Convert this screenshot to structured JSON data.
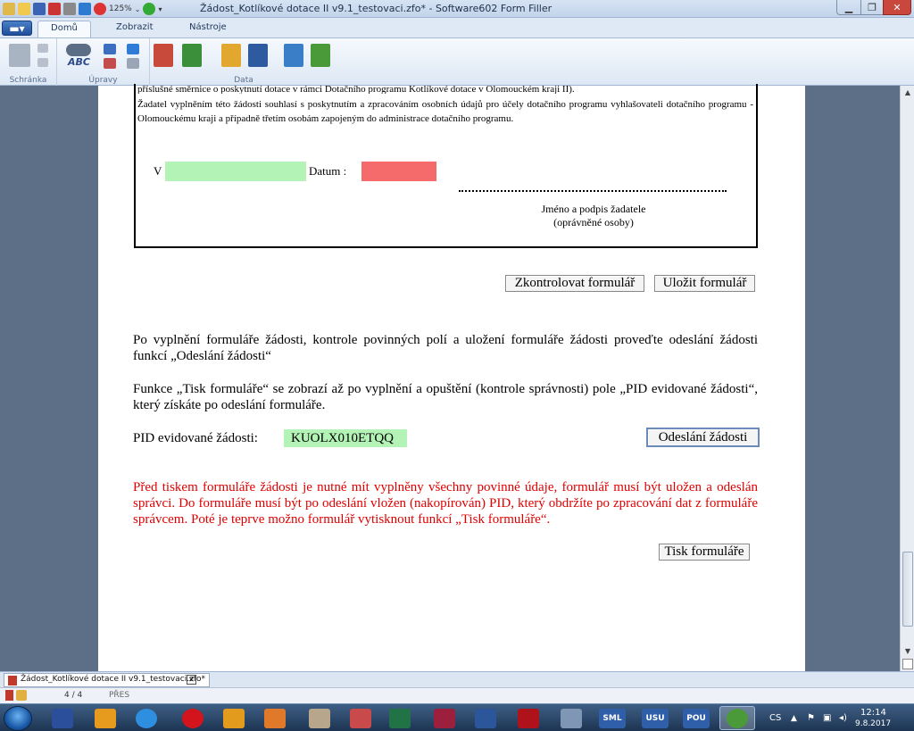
{
  "window": {
    "title": "Žádost_Kotlíkové dotace II v9.1_testovaci.zfo* - Software602 Form Filler",
    "zoom": "125%"
  },
  "ribbon": {
    "tabs": [
      "Domů",
      "Zobrazit",
      "Nástroje"
    ],
    "active_tab": "Domů",
    "groups": {
      "clipboard": "Schránka",
      "edit": "Úpravy",
      "data": "Data"
    },
    "spell_label": "ABC"
  },
  "form": {
    "consent_top": "příslušné směrnice o poskytnutí dotace v rámci Dotačního programu Kotlíkové dotace v Olomouckém kraji II).",
    "consent_text": "Žadatel vyplněním této žádosti souhlasí s poskytnutím a zpracováním osobních údajů pro účely dotačního programu vyhlašovateli dotačního programu - Olomouckému kraji a případně třetím osobám zapojeným do administrace dotačního programu.",
    "place_label": "V",
    "date_label": "Datum :",
    "signature_line1": "Jméno a podpis žadatele",
    "signature_line2": "(oprávněné osoby)",
    "check_button": "Zkontrolovat formulář",
    "save_button": "Uložit formulář",
    "instruction1": "Po vyplnění formuláře žádosti, kontrole povinných polí a uložení formuláře žádosti proveďte odeslání žádosti funkcí „Odeslání žádosti“",
    "instruction2": "Funkce „Tisk formuláře“ se zobrazí až po vyplnění a opuštění (kontrole správnosti) pole „PID evidované žádosti“, který získáte po odeslání formuláře.",
    "pid_label": "PID evidované žádosti:",
    "pid_value": "KUOLX010ETQQ",
    "send_button": "Odeslání žádosti",
    "warning": "Před tiskem formuláře žádosti je nutné mít vyplněny všechny povinné údaje, formulář musí být uložen a odeslán správci. Do formuláře musí být po odeslání vložen (nakopírován) PID, který obdržíte po zpracování dat z formuláře správcem. Poté je teprve možno formulář vytisknout funkcí „Tisk formuláře“.",
    "print_button": "Tisk formuláře"
  },
  "document_tab": "Žádost_Kotlíkové dotace II v9.1_testovaci.zfo*",
  "status": {
    "pages": "4 / 4",
    "mode": "PŘES"
  },
  "taskbar": {
    "apps": [
      "SML",
      "USU",
      "POU"
    ],
    "language": "CS",
    "time": "12:14",
    "date": "9.8.2017"
  },
  "colors": {
    "place_field": "#b3f3b6",
    "date_field": "#f56b6b",
    "pid_field": "#b3f3b6",
    "warning_text": "#e00000"
  }
}
